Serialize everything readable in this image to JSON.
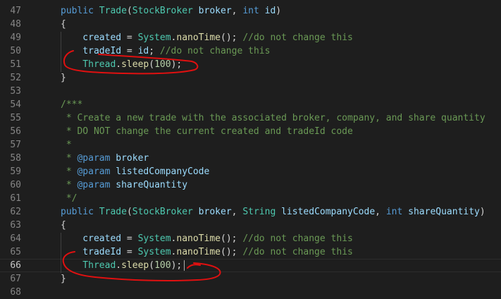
{
  "editor": {
    "lines": [
      {
        "num": "47",
        "tokens": [
          [
            "k",
            "public "
          ],
          [
            "t",
            "Trade"
          ],
          [
            "p",
            "("
          ],
          [
            "t",
            "StockBroker"
          ],
          [
            "v",
            " broker"
          ],
          [
            "p",
            ", "
          ],
          [
            "k",
            "int"
          ],
          [
            "v",
            " id"
          ],
          [
            "p",
            ")"
          ]
        ]
      },
      {
        "num": "48",
        "tokens": [
          [
            "p",
            "{"
          ]
        ]
      },
      {
        "num": "49",
        "tokens": [
          [
            "v",
            "    created"
          ],
          [
            "p",
            " = "
          ],
          [
            "t",
            "System"
          ],
          [
            "p",
            "."
          ],
          [
            "f",
            "nanoTime"
          ],
          [
            "p",
            "(); "
          ],
          [
            "c",
            "//do not change this"
          ]
        ]
      },
      {
        "num": "50",
        "tokens": [
          [
            "v",
            "    tradeId"
          ],
          [
            "p",
            " = "
          ],
          [
            "v",
            "id"
          ],
          [
            "p",
            "; "
          ],
          [
            "c",
            "//do not change this"
          ]
        ]
      },
      {
        "num": "51",
        "tokens": [
          [
            "t",
            "    Thread"
          ],
          [
            "p",
            "."
          ],
          [
            "f",
            "sleep"
          ],
          [
            "p",
            "("
          ],
          [
            "n",
            "100"
          ],
          [
            "p",
            ");"
          ]
        ]
      },
      {
        "num": "52",
        "tokens": [
          [
            "p",
            "}"
          ]
        ]
      },
      {
        "num": "53",
        "tokens": []
      },
      {
        "num": "54",
        "tokens": [
          [
            "c",
            "/***"
          ]
        ]
      },
      {
        "num": "55",
        "tokens": [
          [
            "c",
            " * Create a new trade with the associated broker, company, and share quantity"
          ]
        ]
      },
      {
        "num": "56",
        "tokens": [
          [
            "c",
            " * DO NOT change the current created and tradeId code"
          ]
        ]
      },
      {
        "num": "57",
        "tokens": [
          [
            "c",
            " *"
          ]
        ]
      },
      {
        "num": "58",
        "tokens": [
          [
            "c",
            " * "
          ],
          [
            "k",
            "@param"
          ],
          [
            "v",
            " broker"
          ]
        ]
      },
      {
        "num": "59",
        "tokens": [
          [
            "c",
            " * "
          ],
          [
            "k",
            "@param"
          ],
          [
            "v",
            " listedCompanyCode"
          ]
        ]
      },
      {
        "num": "60",
        "tokens": [
          [
            "c",
            " * "
          ],
          [
            "k",
            "@param"
          ],
          [
            "v",
            " shareQuantity"
          ]
        ]
      },
      {
        "num": "61",
        "tokens": [
          [
            "c",
            " */"
          ]
        ]
      },
      {
        "num": "62",
        "tokens": [
          [
            "k",
            "public "
          ],
          [
            "t",
            "Trade"
          ],
          [
            "p",
            "("
          ],
          [
            "t",
            "StockBroker"
          ],
          [
            "v",
            " broker"
          ],
          [
            "p",
            ", "
          ],
          [
            "t",
            "String"
          ],
          [
            "v",
            " listedCompanyCode"
          ],
          [
            "p",
            ", "
          ],
          [
            "k",
            "int"
          ],
          [
            "v",
            " shareQuantity"
          ],
          [
            "p",
            ")"
          ]
        ]
      },
      {
        "num": "63",
        "tokens": [
          [
            "p",
            "{"
          ]
        ]
      },
      {
        "num": "64",
        "tokens": [
          [
            "v",
            "    created"
          ],
          [
            "p",
            " = "
          ],
          [
            "t",
            "System"
          ],
          [
            "p",
            "."
          ],
          [
            "f",
            "nanoTime"
          ],
          [
            "p",
            "(); "
          ],
          [
            "c",
            "//do not change this"
          ]
        ]
      },
      {
        "num": "65",
        "tokens": [
          [
            "v",
            "    tradeId"
          ],
          [
            "p",
            " = "
          ],
          [
            "t",
            "System"
          ],
          [
            "p",
            "."
          ],
          [
            "f",
            "nanoTime"
          ],
          [
            "p",
            "(); "
          ],
          [
            "c",
            "//do not change this"
          ]
        ]
      },
      {
        "num": "66",
        "tokens": [
          [
            "t",
            "    Thread"
          ],
          [
            "p",
            "."
          ],
          [
            "f",
            "sleep"
          ],
          [
            "p",
            "("
          ],
          [
            "n",
            "100"
          ],
          [
            "p",
            ");"
          ]
        ],
        "current": true
      },
      {
        "num": "67",
        "tokens": [
          [
            "p",
            "}"
          ]
        ]
      },
      {
        "num": "68",
        "tokens": []
      }
    ]
  },
  "colors": {
    "background": "#1e1e1e",
    "keyword": "#569cd6",
    "type": "#4ec9b0",
    "function": "#dcdcaa",
    "variable": "#9cdcfe",
    "number": "#b5cea8",
    "comment": "#6a9955",
    "annotation": "#e01010"
  }
}
